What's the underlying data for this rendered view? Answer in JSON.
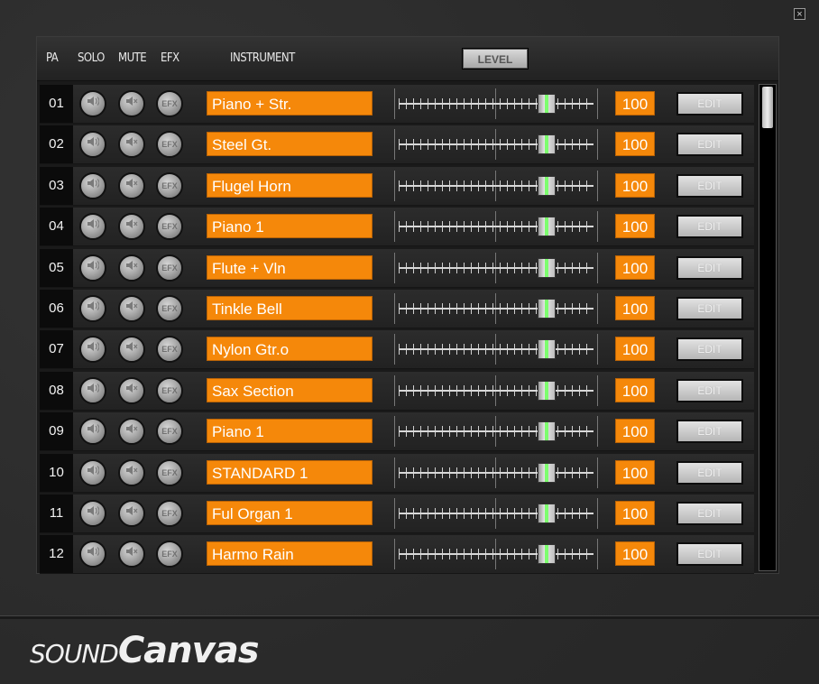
{
  "window": {
    "close_glyph": "×",
    "close_icon": "close-icon"
  },
  "header": {
    "part": "PA",
    "solo": "SOLO",
    "mute": "MUTE",
    "efx": "EFX",
    "instrument": "INSTRUMENT",
    "level_button": "LEVEL"
  },
  "row_buttons": {
    "solo_icon": "speaker-icon",
    "mute_icon": "speaker-mute-icon",
    "efx_label": "EFX",
    "edit_label": "EDIT"
  },
  "parts": [
    {
      "num": "01",
      "instrument": "Piano + Str.",
      "level": "100",
      "level_value": 100
    },
    {
      "num": "02",
      "instrument": "Steel Gt.",
      "level": "100",
      "level_value": 100
    },
    {
      "num": "03",
      "instrument": "Flugel Horn",
      "level": "100",
      "level_value": 100
    },
    {
      "num": "04",
      "instrument": "Piano 1",
      "level": "100",
      "level_value": 100
    },
    {
      "num": "05",
      "instrument": "Flute + Vln",
      "level": "100",
      "level_value": 100
    },
    {
      "num": "06",
      "instrument": "Tinkle Bell",
      "level": "100",
      "level_value": 100
    },
    {
      "num": "07",
      "instrument": "Nylon Gtr.o",
      "level": "100",
      "level_value": 100
    },
    {
      "num": "08",
      "instrument": "Sax Section",
      "level": "100",
      "level_value": 100
    },
    {
      "num": "09",
      "instrument": "Piano 1",
      "level": "100",
      "level_value": 100
    },
    {
      "num": "10",
      "instrument": "STANDARD 1",
      "level": "100",
      "level_value": 100
    },
    {
      "num": "11",
      "instrument": "Ful Organ 1",
      "level": "100",
      "level_value": 100
    },
    {
      "num": "12",
      "instrument": "Harmo Rain",
      "level": "100",
      "level_value": 100
    }
  ],
  "level_max": 127,
  "colors": {
    "orange": "#f5880a",
    "knob_indicator": "#7dff6e"
  },
  "footer": {
    "logo_a": "SOUND",
    "logo_b": "Canvas"
  }
}
